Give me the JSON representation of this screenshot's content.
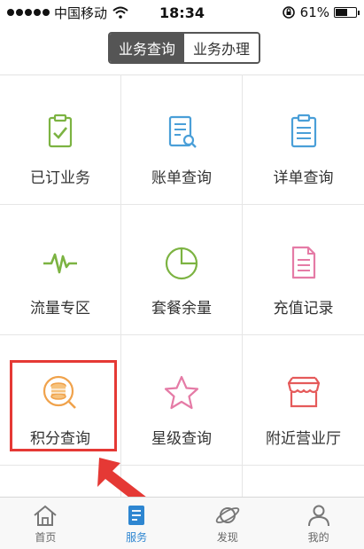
{
  "status_bar": {
    "carrier": "中国移动",
    "time": "18:34",
    "battery": "61%",
    "battery_level": 0.61
  },
  "segment": {
    "tabs": [
      {
        "label": "业务查询",
        "active": true
      },
      {
        "label": "业务办理",
        "active": false
      }
    ]
  },
  "grid": {
    "items": [
      {
        "label": "已订业务",
        "icon": "clipboard-check-icon",
        "color": "#7cb342"
      },
      {
        "label": "账单查询",
        "icon": "bill-search-icon",
        "color": "#4a9fd8"
      },
      {
        "label": "详单查询",
        "icon": "detail-list-icon",
        "color": "#4a9fd8"
      },
      {
        "label": "流量专区",
        "icon": "pulse-icon",
        "color": "#7cb342"
      },
      {
        "label": "套餐余量",
        "icon": "pie-chart-icon",
        "color": "#7cb342"
      },
      {
        "label": "充值记录",
        "icon": "document-icon",
        "color": "#e57ba6"
      },
      {
        "label": "积分查询",
        "icon": "coin-search-icon",
        "color": "#f0a24b"
      },
      {
        "label": "星级查询",
        "icon": "star-icon",
        "color": "#e57ba6"
      },
      {
        "label": "附近营业厅",
        "icon": "store-icon",
        "color": "#e55a5a"
      }
    ]
  },
  "tabbar": {
    "tabs": [
      {
        "label": "首页",
        "icon": "home-icon",
        "active": false
      },
      {
        "label": "服务",
        "icon": "service-icon",
        "active": true
      },
      {
        "label": "发现",
        "icon": "planet-icon",
        "active": false
      },
      {
        "label": "我的",
        "icon": "user-icon",
        "active": false
      }
    ]
  },
  "colors": {
    "accent": "#2e86d1",
    "highlight": "#e53935",
    "segment_active": "#555555"
  }
}
